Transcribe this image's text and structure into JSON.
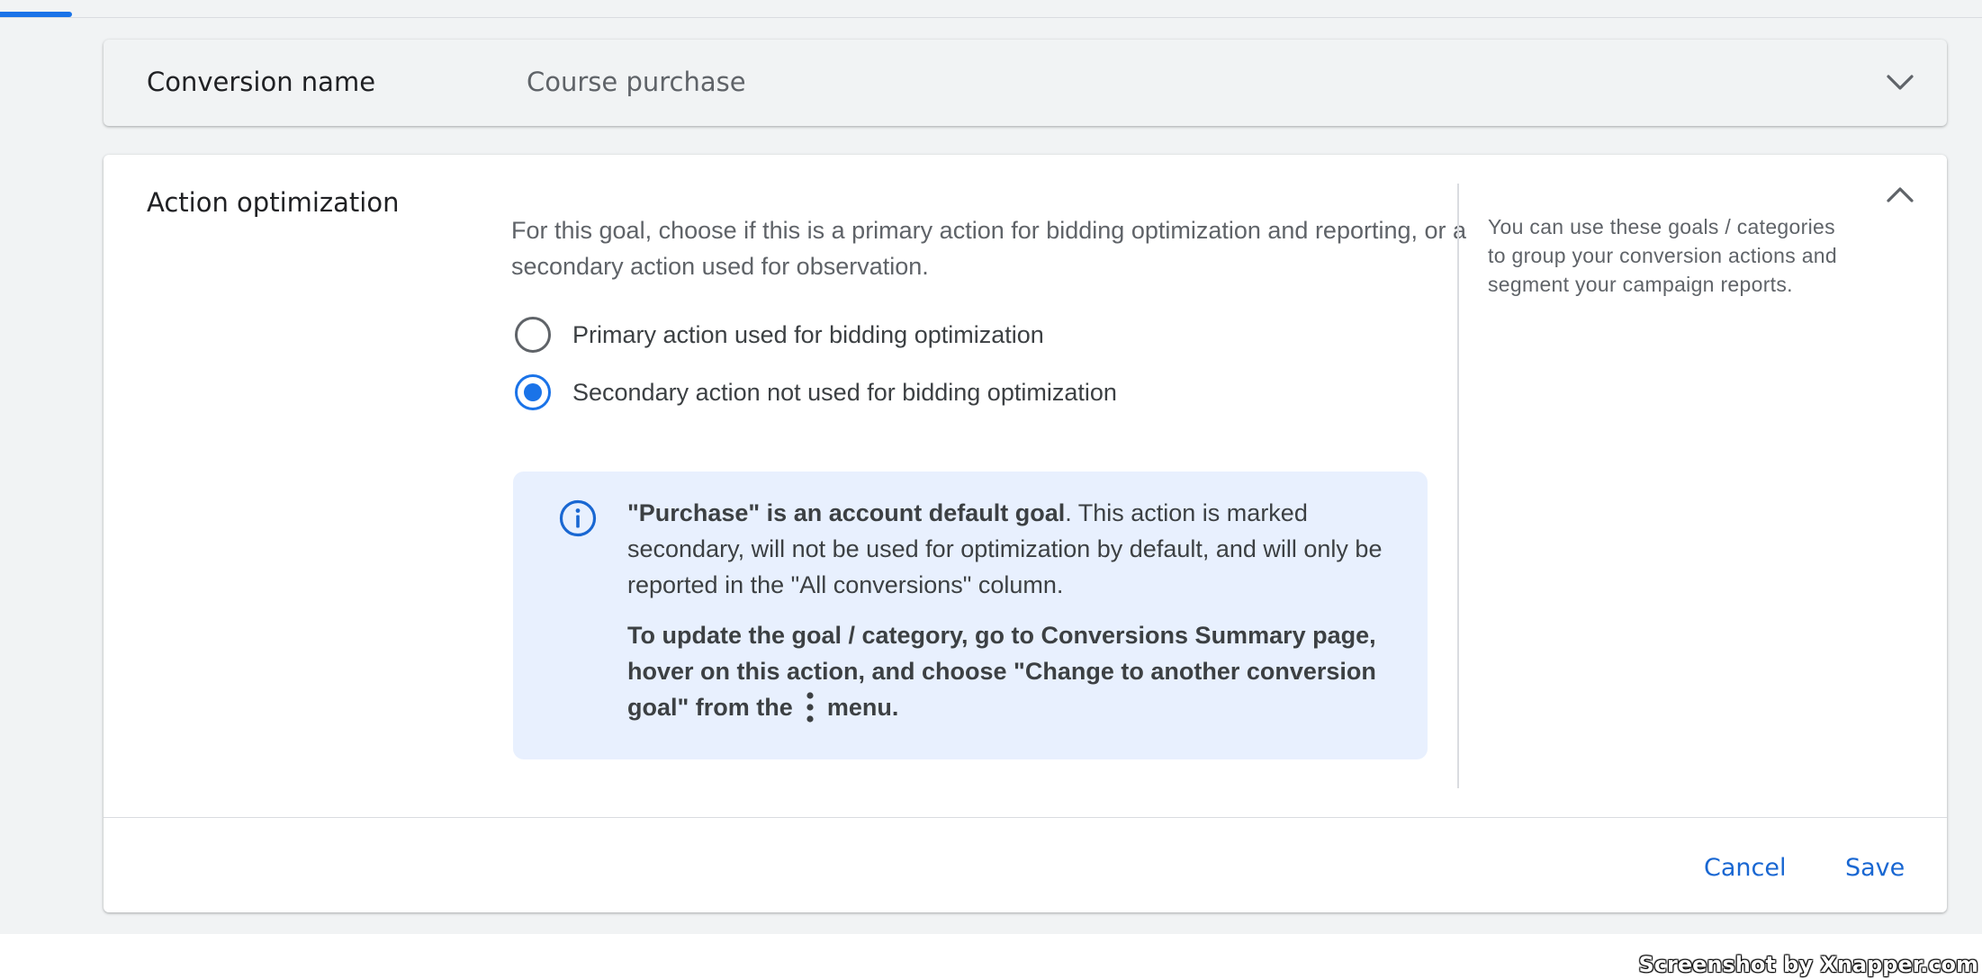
{
  "colors": {
    "accent": "#1a73e8",
    "link": "#1967d2",
    "info_background": "#e8f0fe",
    "page_background": "#f1f3f4"
  },
  "conversion_name": {
    "label": "Conversion name",
    "value": "Course purchase",
    "toggle_icon": "chevron-down-icon"
  },
  "action_optimization": {
    "label": "Action optimization",
    "toggle_icon": "chevron-up-icon",
    "description": "For this goal, choose if this is a primary action for bidding optimization and reporting, or a secondary action used for observation.",
    "options": [
      {
        "label": "Primary action used for bidding optimization",
        "selected": false
      },
      {
        "label": "Secondary action not used for bidding optimization",
        "selected": true
      }
    ],
    "notice": {
      "icon": "info-icon",
      "title": "\"Purchase\" is an account default goal",
      "body": ". This action is marked secondary, will not be used for optimization by default, and will only be reported in the \"All conversions\" column.",
      "instruction_before_icon": "To update the goal / category, go to Conversions Summary page, hover on this action, and choose \"Change to another conversion goal\" from the",
      "instruction_icon": "more-vert-icon",
      "instruction_after_icon": "menu."
    },
    "helper_text": "You can use these goals / categories to group your conversion actions and segment your campaign reports."
  },
  "footer": {
    "cancel_label": "Cancel",
    "save_label": "Save"
  },
  "watermark": "Screenshot by Xnapper.com"
}
